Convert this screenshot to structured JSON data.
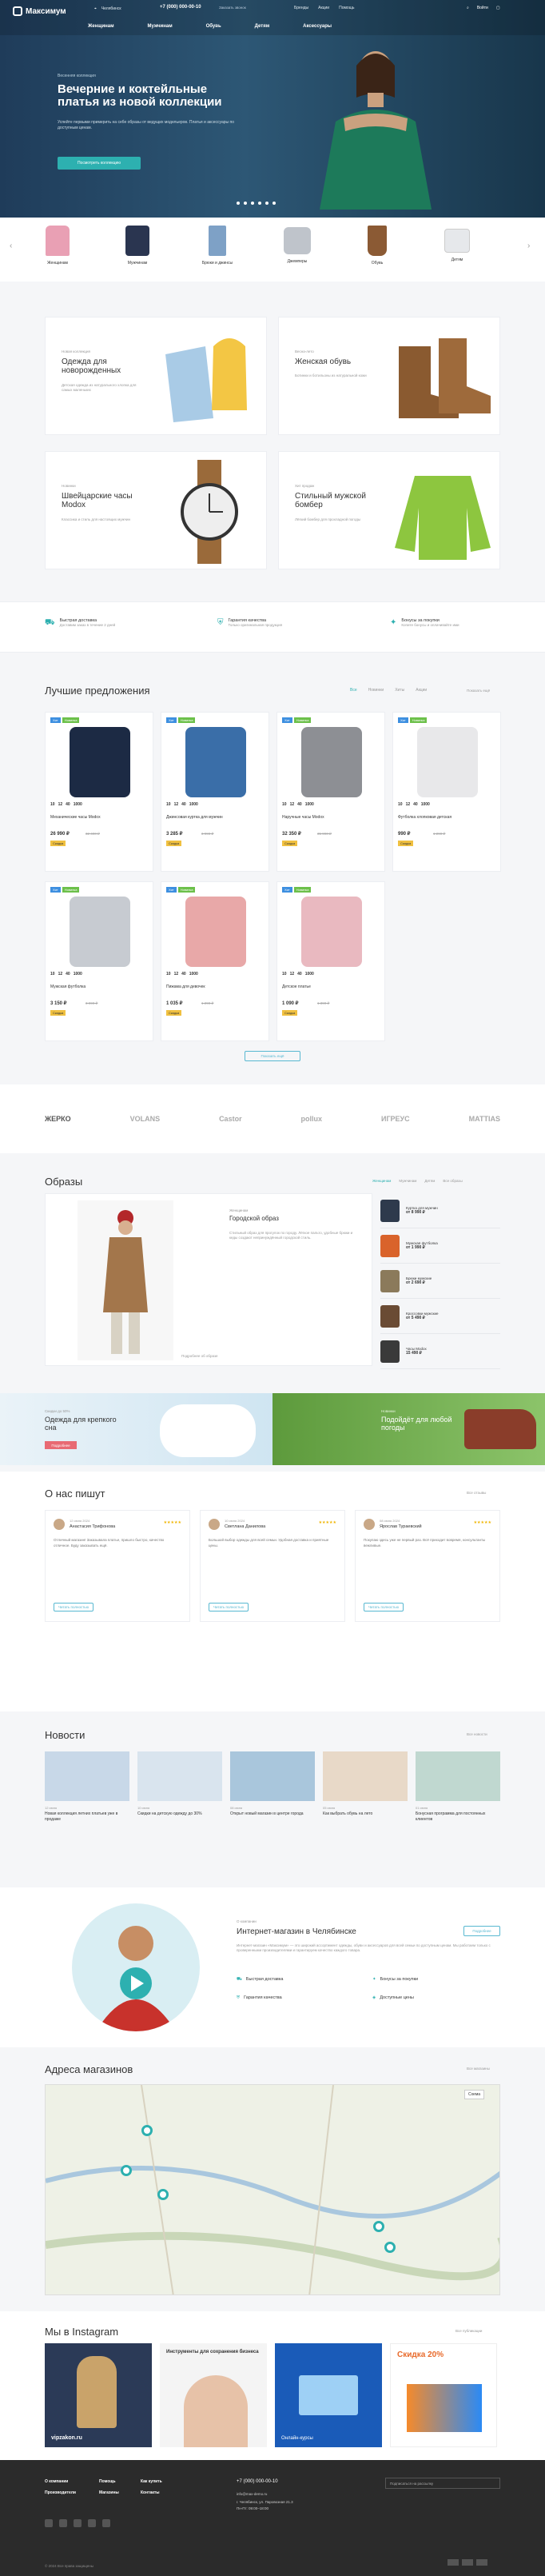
{
  "topbar": {
    "logo": "Максимум",
    "city": "Челябинск",
    "phone": "+7 (000) 000-00-10",
    "callback": "Заказать звонок",
    "links": [
      "Бренды",
      "Акции",
      "Помощь"
    ],
    "login": "Войти",
    "search": "Поиск"
  },
  "nav": [
    "Женщинам",
    "Мужчинам",
    "Обувь",
    "Детям",
    "Аксессуары"
  ],
  "hero": {
    "tag": "Весенняя коллекция",
    "title": "Вечерние и коктейльные платья из новой коллекции",
    "text": "Успейте первыми примерить на себе образы от ведущих модельеров. Платья и аксессуары по доступным ценам.",
    "button": "Посмотреть коллекцию"
  },
  "categories": [
    "Женщинам",
    "Мужчинам",
    "Брюки и джинсы",
    "Джемперы",
    "Обувь",
    "Детям"
  ],
  "promo": [
    {
      "tag": "Новая коллекция",
      "title": "Одежда для новорожденных",
      "text": "Детская одежда из натурального хлопка для самых маленьких"
    },
    {
      "tag": "Весна-лето",
      "title": "Женская обувь",
      "text": "Ботинки и ботильоны из натуральной кожи"
    },
    {
      "tag": "Новинки",
      "title": "Швейцарские часы Modox",
      "text": "Классика и стиль для настоящих мужчин"
    },
    {
      "tag": "Хит продаж",
      "title": "Стильный мужской бомбер",
      "text": "Лёгкий бомбер для прохладной погоды"
    }
  ],
  "features": [
    {
      "title": "Быстрая доставка",
      "text": "Доставим заказ в течение 2 дней",
      "icon": "truck-icon"
    },
    {
      "title": "Гарантия качества",
      "text": "Только оригинальная продукция",
      "icon": "shield-icon"
    },
    {
      "title": "Бонусы за покупки",
      "text": "Копите бонусы и оплачивайте ими",
      "icon": "gift-icon"
    }
  ],
  "best": {
    "title": "Лучшие предложения",
    "tabs": [
      "Все",
      "Новинки",
      "Хиты",
      "Акции"
    ],
    "more": "Показать ещё",
    "badges": [
      "Хит",
      "Новинка",
      "Скидка"
    ],
    "products": [
      {
        "name": "Механические часы Modox",
        "price": "26 990 ₽",
        "old": "32 490 ₽",
        "color": "#1c2a44",
        "timer": [
          "10",
          "12",
          "40",
          "1000"
        ]
      },
      {
        "name": "Джинсовая куртка для мужчин",
        "price": "3 285 ₽",
        "old": "3 990 ₽",
        "color": "#3a6ea8",
        "timer": [
          "10",
          "12",
          "40",
          "1000"
        ]
      },
      {
        "name": "Наручные часы Modox",
        "price": "32 350 ₽",
        "old": "35 990 ₽",
        "color": "#8d8f94",
        "timer": [
          "10",
          "12",
          "40",
          "1000"
        ]
      },
      {
        "name": "Футболка хлопковая детская",
        "price": "990 ₽",
        "old": "1 290 ₽",
        "color": "#e8e8ea",
        "timer": [
          "10",
          "12",
          "40",
          "1000"
        ]
      },
      {
        "name": "Мужская футболка",
        "price": "3 150 ₽",
        "old": "3 990 ₽",
        "color": "#c7cbd1",
        "timer": [
          "10",
          "12",
          "40",
          "1000"
        ]
      },
      {
        "name": "Пижама для девочек",
        "price": "1 035 ₽",
        "old": "1 290 ₽",
        "color": "#e8a8a8",
        "timer": [
          "10",
          "12",
          "40",
          "1000"
        ]
      },
      {
        "name": "Детское платье",
        "price": "1 090 ₽",
        "old": "1 390 ₽",
        "color": "#e9b9c0",
        "timer": [
          "10",
          "12",
          "40",
          "1000"
        ]
      }
    ],
    "pager": "Показать ещё"
  },
  "brands": [
    "ЖЕРКО",
    "VOLANS",
    "Castor",
    "pollux",
    "ИГРЕУС",
    "MATTIAS"
  ],
  "looks": {
    "title": "Образы",
    "tabs": [
      "Женщинам",
      "Мужчинам",
      "Детям",
      "Все образы"
    ],
    "look_tag": "Женщинам",
    "look_title": "Городской образ",
    "look_text": "Стильный образ для прогулок по городу. Лёгкое пальто, удобные брюки и кеды создают непринуждённый городской стиль.",
    "more": "Подробнее об образе",
    "items": [
      {
        "name": "Куртка для мужчин",
        "price": "от 8 990 ₽",
        "color": "#2e3a4c"
      },
      {
        "name": "Мужская футболка",
        "price": "от 1 990 ₽",
        "color": "#d9632b"
      },
      {
        "name": "Брюки мужские",
        "price": "от 2 690 ₽",
        "color": "#8b7a5b"
      },
      {
        "name": "Кроссовки мужские",
        "price": "от 5 490 ₽",
        "color": "#6a4b34"
      },
      {
        "name": "Часы Modox",
        "price": "15 490 ₽",
        "color": "#3a3a3a"
      }
    ]
  },
  "banners": [
    {
      "tag": "Скидки до 50%",
      "title": "Одежда для крепкого сна",
      "button": "Подробнее"
    },
    {
      "tag": "Новинки",
      "title": "Подойдёт для любой погоды",
      "button": "Подробнее"
    }
  ],
  "reviews": {
    "title": "О нас пишут",
    "link": "Все отзывы",
    "items": [
      {
        "name": "Анастасия Трифонова",
        "date": "12 июня 2024",
        "text": "Отличный магазин! Заказывала платье, пришло быстро, качество отличное. Буду заказывать ещё.",
        "more": "Читать полностью"
      },
      {
        "name": "Светлана Данилова",
        "date": "10 июня 2024",
        "text": "Большой выбор одежды для всей семьи. Удобная доставка и приятные цены.",
        "more": "Читать полностью"
      },
      {
        "name": "Ярослав Тураевский",
        "date": "08 июня 2024",
        "text": "Покупаю здесь уже не первый раз. Всё приходит вовремя, консультанты вежливые.",
        "more": "Читать полностью"
      }
    ]
  },
  "news": {
    "title": "Новости",
    "link": "Все новости",
    "items": [
      {
        "date": "12 июня",
        "title": "Новая коллекция летних платьев уже в продаже",
        "color": "#c8d8e8"
      },
      {
        "date": "10 июня",
        "title": "Скидки на детскую одежду до 30%",
        "color": "#d9e4ee"
      },
      {
        "date": "08 июня",
        "title": "Открыт новый магазин в центре города",
        "color": "#a9c6dc"
      },
      {
        "date": "05 июня",
        "title": "Как выбрать обувь на лето",
        "color": "#e8d9c8"
      },
      {
        "date": "01 июня",
        "title": "Бонусная программа для постоянных клиентов",
        "color": "#c0d8d0"
      }
    ]
  },
  "about": {
    "tag": "О компании",
    "title": "Интернет-магазин в Челябинске",
    "text": "Интернет-магазин «Максимум» — это широкий ассортимент одежды, обуви и аксессуаров для всей семьи по доступным ценам. Мы работаем только с проверенными производителями и гарантируем качество каждого товара.",
    "button": "Подробнее",
    "features": [
      "Быстрая доставка",
      "Бонусы за покупки",
      "Гарантия качества",
      "Доступные цены"
    ]
  },
  "stores": {
    "title": "Адреса магазинов",
    "link": "Все магазины",
    "map_label": "Схема"
  },
  "insta": {
    "title": "Мы в Instagram",
    "link": "Все публикации",
    "posts": [
      "vipzakon.ru",
      "Инструменты для сохранения бизнеса",
      "Онлайн-курсы",
      "Скидка 20%"
    ]
  },
  "footer": {
    "menu": [
      [
        "О компании",
        "Помощь",
        "Как купить"
      ],
      [
        "Производители",
        "Магазины",
        "Контакты"
      ]
    ],
    "phone": "+7 (000) 000-00-10",
    "email": "info@max-demo.ru",
    "address": "г. Челябинск, ул. Паровозная 21.3",
    "hours": "Пн-Пт: 09:00–18:00",
    "subscribe": "Подписаться на рассылку",
    "copyright": "© 2024 Все права защищены"
  },
  "colors": {
    "accent": "#2db0b0",
    "dark": "#2b2b2b",
    "sale": "#f0c040"
  }
}
